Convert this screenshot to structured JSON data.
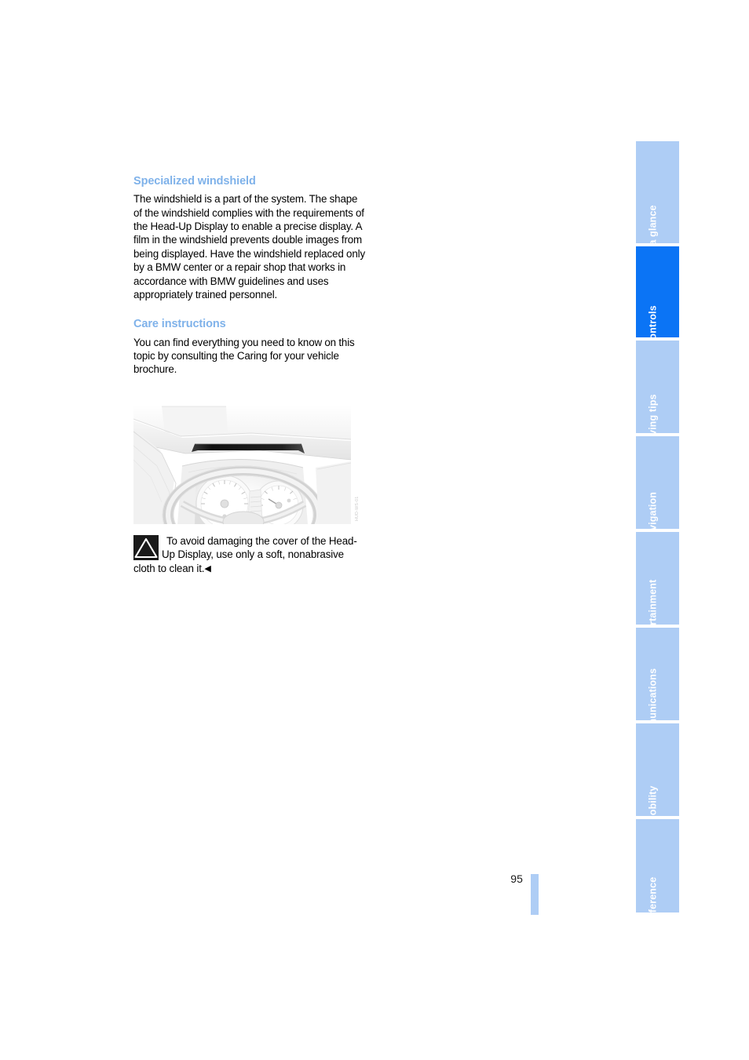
{
  "document": {
    "page_number": "95"
  },
  "sections": [
    {
      "heading": "Specialized windshield",
      "body": "The windshield is a part of the system. The shape of the windshield complies with the requirements of the Head-Up Display to enable a precise display. A film in the windshield prevents double images from being displayed. Have the windshield replaced only by a BMW center or a repair shop that works in accordance with BMW guidelines and uses appropriately trained personnel."
    },
    {
      "heading": "Care instructions",
      "body": "You can find everything you need to know on this topic by consulting the Caring for your vehicle brochure."
    }
  ],
  "illustration": {
    "alt": "Car dashboard with steering wheel, instrument cluster and Head-Up Display projector cover",
    "figure_code": "HUD-WS-01"
  },
  "warning": {
    "icon": "warning-triangle-icon",
    "text": "To avoid damaging the cover of the Head-Up Display, use only a soft, nonabrasive cloth to clean it.",
    "end_marker": "◀"
  },
  "tab_rail": {
    "active_index": 1,
    "tabs": [
      {
        "label": "At a glance"
      },
      {
        "label": "Controls"
      },
      {
        "label": "Driving tips"
      },
      {
        "label": "Navigation"
      },
      {
        "label": "Entertainment"
      },
      {
        "label": "Communications"
      },
      {
        "label": "Mobility"
      },
      {
        "label": "Reference"
      }
    ]
  },
  "colors": {
    "heading": "#7FB2EA",
    "tab_active": "#0B74F5",
    "tab_inactive": "#AECDF5",
    "page_bar": "#AECDF5",
    "body_text": "#000000"
  }
}
